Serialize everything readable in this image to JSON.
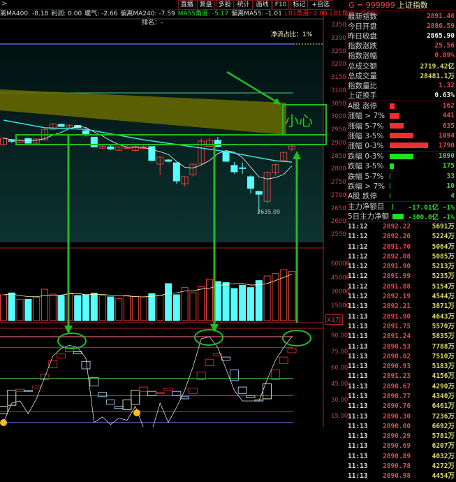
{
  "topbar": {
    "menu": [
      "直播",
      "复盘",
      "多股",
      "统计",
      "画线",
      "F10",
      "标记",
      "+自选"
    ]
  },
  "indicators": [
    {
      "text": "离MA400: -8.18",
      "color": "#dddddd"
    },
    {
      "text": "利润: 0.00",
      "color": "#dddddd"
    },
    {
      "text": "暖气: -2.66",
      "color": "#dddddd"
    },
    {
      "text": "偏离MA240: -7.59",
      "color": "#dddddd"
    },
    {
      "text": "MA55角度: -5.17",
      "color": "#33dd33"
    },
    {
      "text": "偏离MA55: -1.01",
      "color": "#dddddd"
    },
    {
      "text": "LB1角度: 2.00",
      "color": "#ee2222"
    },
    {
      "text": "LB1角度: -0.06◇",
      "color": "#ee2222"
    }
  ],
  "rank": "排名：-",
  "net_flow": "净流占比：1%",
  "annotation_warning": "小心",
  "low_label": "2635.09",
  "volume_unit": "X1万",
  "chart_data": {
    "type": "candlestick",
    "price_axis": {
      "ticks": [
        "3350",
        "3300",
        "3250",
        "3200",
        "3150",
        "3100",
        "3050",
        "3000",
        "2950",
        "2900",
        "2850",
        "2800",
        "2750",
        "2700",
        "2650",
        "2600",
        "2550"
      ],
      "range": [
        2550,
        3350
      ]
    },
    "candles": [
      [
        2897,
        2921,
        2925,
        2890
      ],
      [
        2912,
        2910,
        2918,
        2902
      ],
      [
        2905,
        2912,
        2915,
        2903
      ],
      [
        2920,
        2902,
        2922,
        2900
      ],
      [
        2902,
        2918,
        2920,
        2900
      ],
      [
        2915,
        2955,
        2958,
        2912
      ],
      [
        2955,
        2976,
        2978,
        2953
      ],
      [
        2974,
        2966,
        2977,
        2964
      ],
      [
        2963,
        2971,
        2974,
        2960
      ],
      [
        2970,
        2962,
        2972,
        2960
      ],
      [
        2950,
        2937,
        2960,
        2928
      ],
      [
        2925,
        2888,
        2926,
        2886
      ],
      [
        2883,
        2891,
        2894,
        2880
      ],
      [
        2888,
        2880,
        2895,
        2876
      ],
      [
        2875,
        2888,
        2891,
        2873
      ],
      [
        2882,
        2886,
        2895,
        2880
      ],
      [
        2874,
        2889,
        2895,
        2870
      ],
      [
        2882,
        2888,
        2893,
        2879
      ],
      [
        2889,
        2836,
        2890,
        2834
      ],
      [
        2822,
        2849,
        2851,
        2780
      ],
      [
        2838,
        2833,
        2842,
        2830
      ],
      [
        2827,
        2758,
        2829,
        2748
      ],
      [
        2747,
        2774,
        2776,
        2738
      ],
      [
        2782,
        2822,
        2824,
        2775
      ],
      [
        2825,
        2910,
        2920,
        2820
      ],
      [
        2890,
        2914,
        2922,
        2888
      ],
      [
        2914,
        2890,
        2926,
        2886
      ],
      [
        2868,
        2833,
        2870,
        2830
      ],
      [
        2817,
        2793,
        2830,
        2785
      ],
      [
        2808,
        2806,
        2828,
        2785
      ],
      [
        2774,
        2730,
        2780,
        2710
      ],
      [
        2718,
        2707,
        2721,
        2635.09
      ],
      [
        2680,
        2790,
        2792,
        2670
      ],
      [
        2790,
        2820,
        2822,
        2778
      ],
      [
        2835,
        2867,
        2869,
        2830
      ],
      [
        2880,
        2891,
        2895,
        2870
      ]
    ],
    "ma_long_anchors": [
      [
        0,
        2990
      ],
      [
        5,
        2961
      ],
      [
        10,
        2955
      ],
      [
        17,
        2915
      ],
      [
        23,
        2888
      ],
      [
        27,
        2870
      ],
      [
        33,
        2835
      ],
      [
        35,
        2830
      ]
    ],
    "volume_axis": {
      "ticks": [
        "60000",
        "45000",
        "30000",
        "15000"
      ],
      "range": [
        0,
        60000
      ]
    },
    "volume": [
      27750,
      29750,
      23000,
      23000,
      25000,
      33750,
      28500,
      27000,
      29500,
      27000,
      27750,
      29500,
      27000,
      25500,
      23500,
      27000,
      26000,
      25500,
      29000,
      27000,
      39750,
      27750,
      35500,
      30000,
      36500,
      44250,
      42000,
      41000,
      34500,
      38000,
      35500,
      43000,
      48000,
      50500,
      54750,
      53000
    ],
    "osc_axis": {
      "ticks": [
        "90.00",
        "75.00",
        "60.00",
        "45.00",
        "30.00",
        "15.00"
      ],
      "range": [
        0,
        95
      ]
    },
    "osc_levels": [
      {
        "value": 90,
        "color": "#e06070"
      },
      {
        "value": 80,
        "color": "#604050"
      },
      {
        "value": 51,
        "color": "#40c040"
      },
      {
        "value": 35,
        "color": "#e02020"
      },
      {
        "value": 20,
        "color": "#207020"
      },
      {
        "value": 10,
        "color": "#5060c0"
      }
    ],
    "osc_line": [
      10,
      28,
      30,
      18,
      32,
      52,
      72,
      79,
      82,
      80,
      70,
      10,
      15,
      8,
      14,
      12,
      25,
      5,
      2,
      28,
      10,
      24,
      40,
      62,
      88,
      90,
      80,
      60,
      40,
      30,
      30,
      30,
      50,
      68,
      80,
      90
    ],
    "osc_boxes": [
      [
        25,
        18,
        "y"
      ],
      [
        40,
        26,
        "y"
      ],
      [
        41,
        39,
        "r"
      ],
      [
        40,
        39,
        "b"
      ],
      [
        44,
        42,
        "r"
      ],
      [
        55,
        50,
        "r"
      ],
      [
        68,
        61,
        "r"
      ],
      [
        74,
        70,
        "r"
      ],
      [
        79,
        76,
        "r"
      ],
      [
        76,
        74,
        "b"
      ],
      [
        67,
        60,
        "b"
      ],
      [
        52,
        44,
        "b"
      ],
      [
        38,
        34,
        "b"
      ],
      [
        31,
        27,
        "b"
      ],
      [
        25,
        23,
        "b"
      ],
      [
        31,
        22,
        "y"
      ],
      [
        40,
        27,
        "y"
      ],
      [
        43,
        39,
        "r"
      ],
      [
        39,
        35,
        "b"
      ],
      [
        38,
        37,
        "r"
      ],
      [
        42,
        40,
        "r"
      ],
      [
        39,
        35,
        "b"
      ],
      [
        34,
        32,
        "b"
      ],
      [
        42,
        37,
        "r"
      ],
      [
        57,
        50,
        "r"
      ],
      [
        69,
        63,
        "r"
      ],
      [
        74,
        72,
        "r"
      ],
      [
        71,
        68,
        "b"
      ],
      [
        59,
        49,
        "b"
      ],
      [
        43,
        37,
        "b"
      ],
      [
        35,
        33,
        "b"
      ],
      [
        31,
        30,
        "b"
      ],
      [
        46,
        32,
        "y"
      ],
      [
        59,
        50,
        "r"
      ],
      [
        71,
        65,
        "r"
      ],
      [
        79,
        75,
        "r"
      ]
    ],
    "colors": {
      "up": "#e04040",
      "down": "#55ffff",
      "annotation": "#22bb22",
      "band": "#6b6b00"
    }
  },
  "panel": {
    "header_code": "G = 999999",
    "header_name": "上证指数",
    "quote": [
      {
        "label": "最新指数",
        "value": "2891.46",
        "color": "#ee4444"
      },
      {
        "label": "今日开盘",
        "value": "2886.59",
        "color": "#ee4444"
      },
      {
        "label": "昨日收盘",
        "value": "2865.90",
        "color": "#eeeeee"
      },
      {
        "label": "指数涨跌",
        "value": "25.56",
        "color": "#ee4444"
      },
      {
        "label": "指数涨幅",
        "value": "0.89%",
        "color": "#ee4444"
      },
      {
        "label": "总成交额",
        "value": "2719.42亿",
        "color": "#dddd66"
      },
      {
        "label": "总成交量",
        "value": "28481.1万",
        "color": "#dddd66"
      },
      {
        "label": "指数量比",
        "value": "1.32",
        "color": "#ee4444"
      },
      {
        "label": "上证换手",
        "value": "0.63%",
        "color": "#eeeeee"
      }
    ],
    "breadth_up": [
      {
        "label": "A股 涨停",
        "value": "162"
      },
      {
        "label": "涨幅 > 7%",
        "value": "441"
      },
      {
        "label": "涨幅 5-7%",
        "value": "635"
      },
      {
        "label": "涨幅 3-5%",
        "value": "1094"
      },
      {
        "label": "涨幅 0-3%",
        "value": "1790"
      }
    ],
    "breadth_down": [
      {
        "label": "跌幅 0-3%",
        "value": "1090"
      },
      {
        "label": "跌幅 3-5%",
        "value": "175"
      },
      {
        "label": "跌幅 5-7%",
        "value": "33"
      },
      {
        "label": "跌幅 > 7%",
        "value": "10"
      },
      {
        "label": "A股 跌停",
        "value": "4"
      }
    ],
    "flows": [
      {
        "label": "主力净额目",
        "value": "-17.01亿",
        "pct": "-1%",
        "bar": 0
      },
      {
        "label": "5日主力净额",
        "value": "-300.0亿",
        "pct": "-1%",
        "bar": 1
      }
    ],
    "ticks": [
      [
        "11:12",
        "2892.22",
        "5691万"
      ],
      [
        "11:12",
        "2892.20",
        "5224万"
      ],
      [
        "11:12",
        "2891.70",
        "5064万"
      ],
      [
        "11:12",
        "2892.08",
        "5085万"
      ],
      [
        "11:12",
        "2891.90",
        "5213万"
      ],
      [
        "11:12",
        "2891.99",
        "5235万"
      ],
      [
        "11:12",
        "2891.88",
        "5154万"
      ],
      [
        "11:12",
        "2892.19",
        "4544万"
      ],
      [
        "11:13",
        "2892.21",
        "3871万"
      ],
      [
        "11:13",
        "2891.90",
        "4643万"
      ],
      [
        "11:13",
        "2891.75",
        "5570万"
      ],
      [
        "11:13",
        "2891.24",
        "5835万"
      ],
      [
        "11:13",
        "2890.53",
        "7788万"
      ],
      [
        "11:13",
        "2890.02",
        "7510万"
      ],
      [
        "11:13",
        "2890.93",
        "5183万"
      ],
      [
        "11:13",
        "2891.23",
        "4156万"
      ],
      [
        "11:13",
        "2890.67",
        "4290万"
      ],
      [
        "11:13",
        "2890.77",
        "4340万"
      ],
      [
        "11:13",
        "2890.76",
        "6461万"
      ],
      [
        "11:13",
        "2890.30",
        "7236万"
      ],
      [
        "11:13",
        "2890.00",
        "6692万"
      ],
      [
        "11:13",
        "2890.29",
        "5781万"
      ],
      [
        "11:13",
        "2890.69",
        "6207万"
      ],
      [
        "11:13",
        "2890.89",
        "4032万"
      ],
      [
        "11:13",
        "2890.78",
        "4272万"
      ],
      [
        "11:13",
        "2890.98",
        "4454万"
      ]
    ]
  }
}
